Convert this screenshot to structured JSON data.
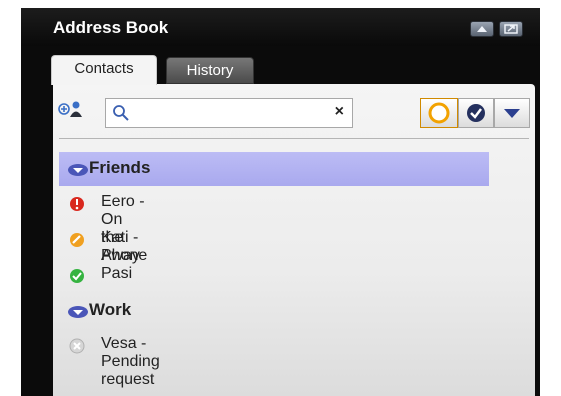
{
  "window": {
    "title": "Address Book"
  },
  "tabs": [
    {
      "label": "Contacts",
      "active": true
    },
    {
      "label": "History",
      "active": false
    }
  ],
  "search": {
    "value": "",
    "placeholder": "",
    "clear_glyph": "×"
  },
  "groups": [
    {
      "name": "Friends",
      "selected": true,
      "contacts": [
        {
          "text": "Eero - On the Phone",
          "status": "busy",
          "color": "#d9281e"
        },
        {
          "text": "Kati - Away",
          "status": "away",
          "color": "#f0a020"
        },
        {
          "text": "Pasi",
          "status": "available",
          "color": "#35b340"
        }
      ]
    },
    {
      "name": "Work",
      "selected": false,
      "contacts": [
        {
          "text": "Vesa - Pending request",
          "status": "pending",
          "color": "#c8c8c8"
        }
      ]
    }
  ],
  "colors": {
    "selection": "#b4b4f2",
    "segment_active": "#f2a200",
    "chrome": "#0b0b0b"
  }
}
